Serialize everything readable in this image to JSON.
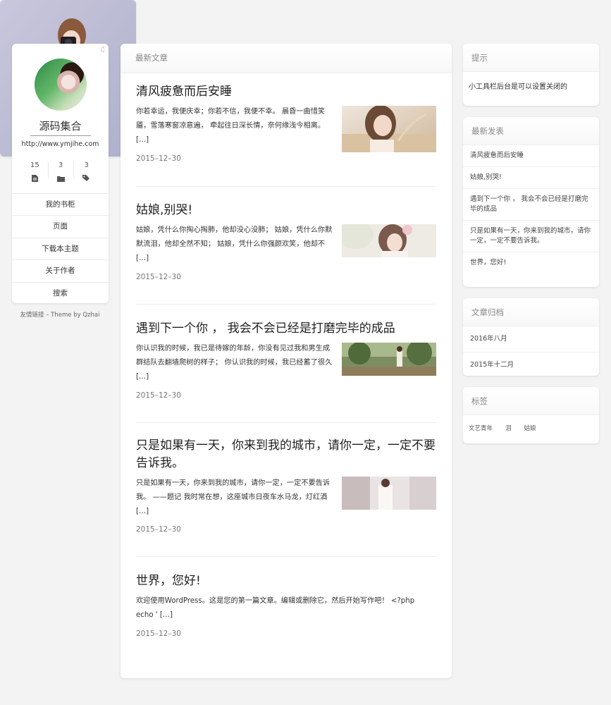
{
  "profile": {
    "site_name": "源码集合",
    "site_url": "http://www.ymjihe.com",
    "stats": [
      {
        "count": "15",
        "icon": "file-icon"
      },
      {
        "count": "3",
        "icon": "folder-icon"
      },
      {
        "count": "3",
        "icon": "tags-icon"
      }
    ],
    "menu": [
      "我的书柜",
      "页面",
      "下载本主题",
      "关于作者",
      "搜索"
    ],
    "footer": "友情链接 – Theme by Qzhai"
  },
  "main": {
    "heading": "最新文章",
    "posts": [
      {
        "title": "清风疲惫而后安睡",
        "excerpt": "你若幸运，我便庆幸；你若不信，我便不幸。 晨昏一曲惜笑靥，雪落寒窗凉意遍， 牵起往日深长情，奈何缘浅今相离。 […]",
        "date": "2015–12–30"
      },
      {
        "title": "姑娘,别哭!",
        "excerpt": "姑娘，凭什么你掏心掏肺，他却没心没肺； 姑娘，凭什么你默默流泪，他却全然不知； 姑娘，凭什么你强颜欢笑，他却不 […]",
        "date": "2015–12–30"
      },
      {
        "title": "遇到下一个你 ， 我会不会已经是打磨完毕的成品",
        "excerpt": "你认识我的时候，我已是待嫁的年龄，你没有见过我和男生成群结队去翻墙爬树的样子； 你认识我的时候，我已经蓄了很久 […]",
        "date": "2015–12–30"
      },
      {
        "title": "只是如果有一天，你来到我的城市，请你一定，一定不要告诉我。",
        "excerpt": "只是如果有一天，你来到我的城市，请你一定，一定不要告诉我。 ——题记 我时常在想，这座城市日夜车水马龙，灯红酒 […]",
        "date": "2015–12–30"
      },
      {
        "title": "世界，您好!",
        "excerpt": "欢迎使用WordPress。这是您的第一篇文章。编辑或删除它，然后开始写作吧！ <?php echo ' […]",
        "date": "2015–12–30"
      }
    ]
  },
  "sidebar": {
    "tip": {
      "heading": "提示",
      "text": "小工具栏后台是可以设置关闭的"
    },
    "recent": {
      "heading": "最新发表",
      "items": [
        "清风疲惫而后安睡",
        "姑娘,别哭!",
        "遇到下一个你 ， 我会不会已经是打磨完毕的成品",
        "只是如果有一天，你来到我的城市，请你一定，一定不要告诉我。",
        "世界，您好!"
      ]
    },
    "archive": {
      "heading": "文章归档",
      "items": [
        "2016年八月",
        "2015年十二月"
      ]
    },
    "tags": {
      "heading": "标签",
      "items": [
        "文艺青年",
        "泪",
        "姑娘"
      ]
    }
  },
  "colors": {
    "background": "#f3f3f4",
    "card": "#ffffff",
    "muted_text": "#888888"
  }
}
